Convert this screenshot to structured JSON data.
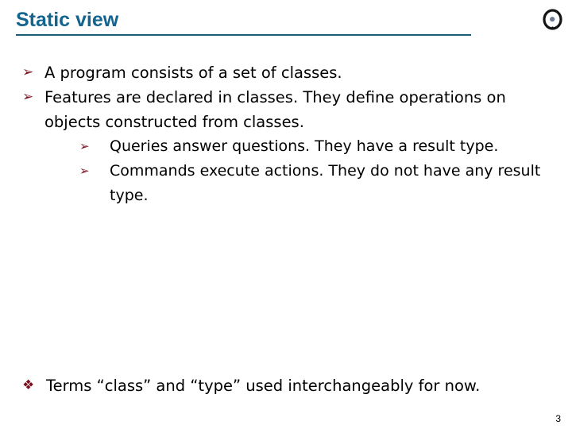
{
  "slide": {
    "title": "Static view",
    "accent_color": "#13658f",
    "rule_color": "#1d5b72",
    "bullet_color": "#7b1220",
    "background_color": "#ffffff",
    "page_number": "3"
  },
  "logo": {
    "name": "circular-disc-logo",
    "outer_color": "#1a1a1a",
    "inner_color": "#6b7a90"
  },
  "bullets": [
    {
      "level": 1,
      "glyph": "➢",
      "glyph_name": "arrowhead-bullet",
      "text": "A program consists of a set of classes."
    },
    {
      "level": 1,
      "glyph": "➢",
      "glyph_name": "arrowhead-bullet",
      "text": "Features are declared in classes. They define operations on objects constructed from classes."
    },
    {
      "level": 2,
      "glyph": "➢",
      "glyph_name": "arrowhead-bullet",
      "text": "Queries answer questions. They have a result type."
    },
    {
      "level": 2,
      "glyph": "➢",
      "glyph_name": "arrowhead-bullet",
      "text": "Commands execute actions. They do not have any result type."
    }
  ],
  "bottom_note": {
    "glyph": "❖",
    "glyph_name": "floret-diamond-bullet",
    "text": "Terms “class” and “type” used interchangeably for now."
  }
}
